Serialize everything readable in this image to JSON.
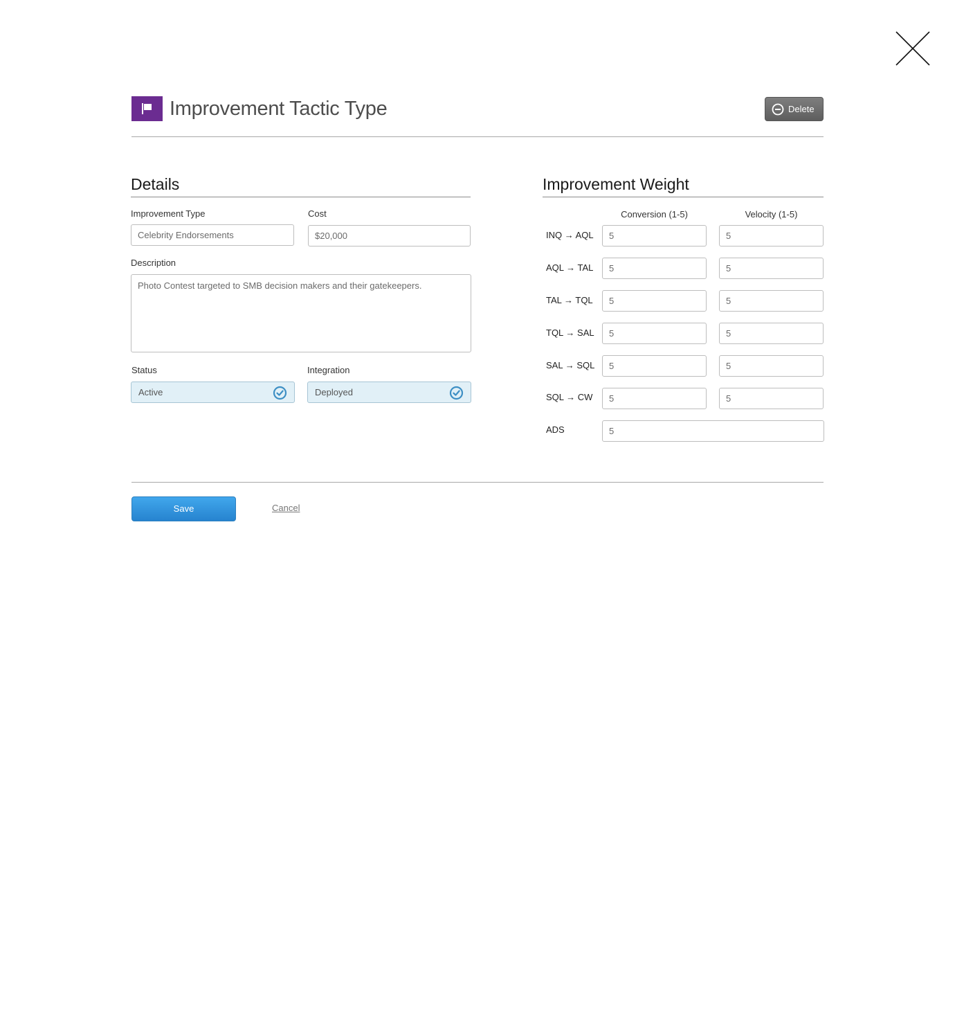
{
  "header": {
    "title": "Improvement Tactic Type",
    "icon": "flag-icon",
    "icon_color": "#6b2c91",
    "delete_label": "Delete"
  },
  "details": {
    "section_title": "Details",
    "improvement_type_label": "Improvement Type",
    "improvement_type_value": "Celebrity Endorsements",
    "cost_label": "Cost",
    "cost_value": "$20,000",
    "description_label": "Description",
    "description_value": "Photo Contest targeted to SMB decision makers and their gatekeepers.",
    "status_label": "Status",
    "status_value": "Active",
    "integration_label": "Integration",
    "integration_value": "Deployed"
  },
  "weight": {
    "section_title": "Improvement Weight",
    "conversion_header": "Conversion (1-5)",
    "velocity_header": "Velocity (1-5)",
    "rows": [
      {
        "label": "INQ → AQL",
        "conversion": "5",
        "velocity": "5"
      },
      {
        "label": "AQL → TAL",
        "conversion": "5",
        "velocity": "5"
      },
      {
        "label": "TAL → TQL",
        "conversion": "5",
        "velocity": "5"
      },
      {
        "label": "TQL → SAL",
        "conversion": "5",
        "velocity": "5"
      },
      {
        "label": "SAL → SQL",
        "conversion": "5",
        "velocity": "5"
      },
      {
        "label": "SQL → CW",
        "conversion": "5",
        "velocity": "5"
      }
    ],
    "ads_label": "ADS",
    "ads_value": "5"
  },
  "footer": {
    "save_label": "Save",
    "cancel_label": "Cancel"
  },
  "colors": {
    "accent": "#2683cf",
    "select_bg": "#e1f0f7",
    "check_color": "#3d8fc4"
  }
}
